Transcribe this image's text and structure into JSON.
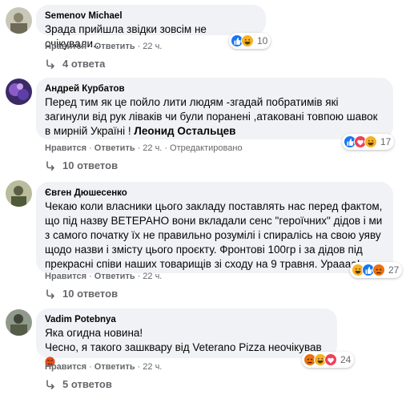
{
  "comments": [
    {
      "author": "Semenov Michael",
      "text": "Зрада прийшла звідки зовсім не очікували..",
      "mention": "",
      "reaction_count": "10",
      "actions": {
        "like": "Нравится",
        "reply": "Ответить",
        "time": "22 ч.",
        "edited": ""
      },
      "replies": "4 ответа"
    },
    {
      "author": "Андрей Курбатов",
      "text": "Перед тим як це пойло лити людям -згадай побратимів які загинули від рук лівaків чи були поранені ,атаковані товпою шавок в мирній Україні !",
      "mention": "Леонид Остальцев",
      "reaction_count": "17",
      "actions": {
        "like": "Нравится",
        "reply": "Ответить",
        "time": "22 ч.",
        "edited": "Отредактировано"
      },
      "replies": "10 ответов"
    },
    {
      "author": "Євген Дюшесенко",
      "text": "Чекаю коли власники цього закладу поставлять нас перед фактом, що під назву ВЕТЕРАНО вони вкладали сенс \"героїчних\" дідов і ми з самого початку їх не правильно розумілі і спиралісь на свою уяву щодо назви і змісту цього проєкту. Фронтові 100гр і за дідов під прекрасні співи наших товарищів зі сходу на 9 травня. Ураааа!",
      "mention": "",
      "reaction_count": "27",
      "actions": {
        "like": "Нравится",
        "reply": "Ответить",
        "time": "22 ч.",
        "edited": ""
      },
      "replies": "10 ответов"
    },
    {
      "author": "Vadim Potebnya",
      "text": "Яка огидна новина!\nЧесно, я такого зашквару від Veterano Pizza неочікував",
      "mention": "",
      "reaction_count": "24",
      "actions": {
        "like": "Нравится",
        "reply": "Ответить",
        "time": "22 ч.",
        "edited": ""
      },
      "replies": "5 ответов"
    }
  ],
  "colors": {
    "bubble": "#f0f2f5",
    "meta": "#65676b",
    "like_blue": "#1877f2",
    "love_red": "#f33e58",
    "haha_yellow": "#f7b125",
    "angry": "#e9710f"
  },
  "icons": [
    "reply-arrow-icon",
    "like-reaction-icon",
    "haha-reaction-icon",
    "love-reaction-icon",
    "angry-reaction-icon",
    "angry-face-emoji"
  ]
}
